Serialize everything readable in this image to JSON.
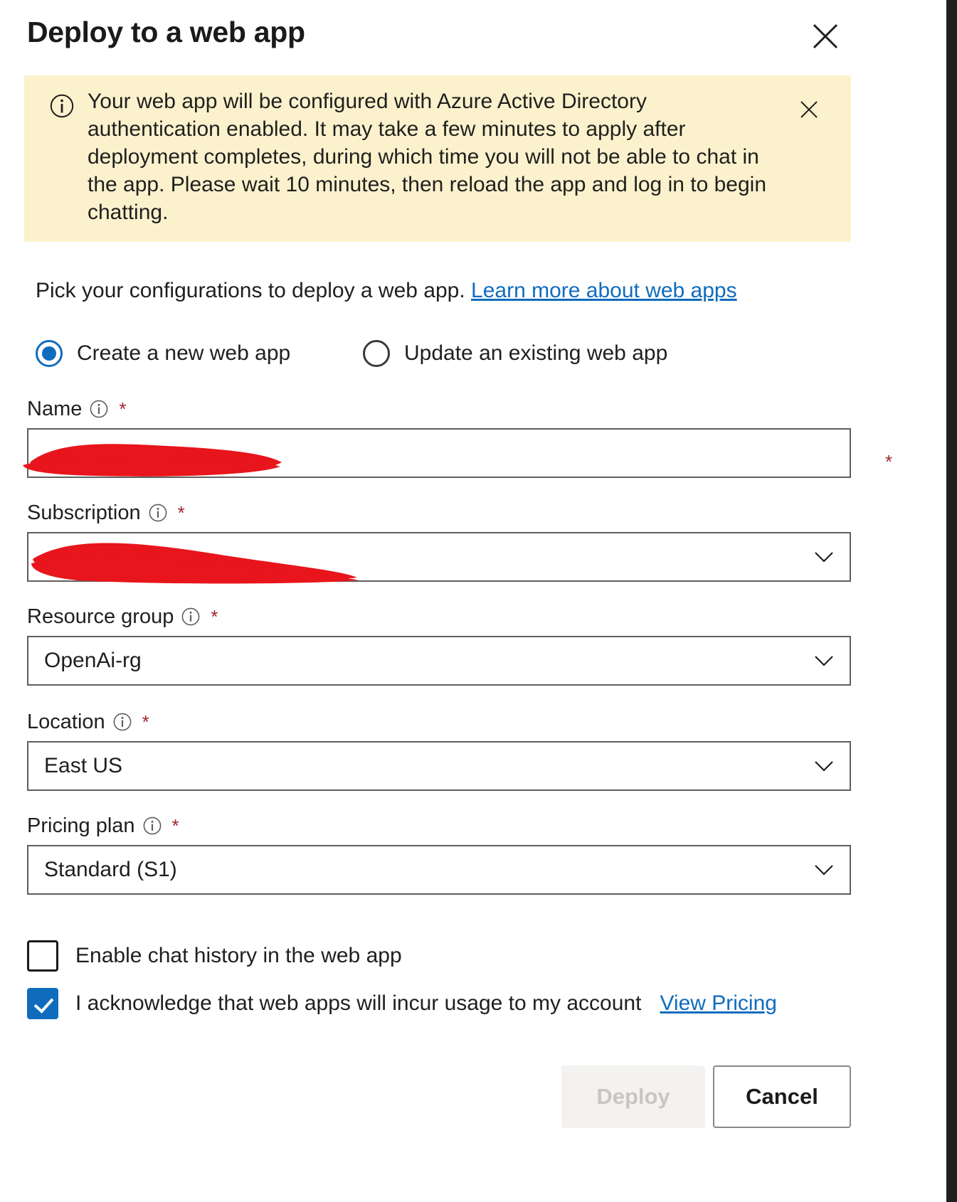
{
  "dialog": {
    "title": "Deploy to a web app",
    "close_icon": "close-icon"
  },
  "banner": {
    "icon": "info-circle-icon",
    "message": "Your web app will be configured with Azure Active Directory authentication enabled. It may take a few minutes to apply after deployment completes, during which time you will not be able to chat in the app. Please wait 10 minutes, then reload the app and log in to begin chatting.",
    "close_icon": "close-icon",
    "background_color": "#FBF2CD"
  },
  "intro": {
    "text": "Pick your configurations to deploy a web app. ",
    "link_text": "Learn more about web apps"
  },
  "mode": {
    "options": [
      {
        "label": "Create a new web app",
        "selected": true
      },
      {
        "label": "Update an existing web app",
        "selected": false
      }
    ]
  },
  "fields": [
    {
      "label": "Name",
      "required_mark": "*",
      "info_icon": "info-circle-icon",
      "type": "text",
      "value": "",
      "redacted": true,
      "outer_required_mark": "*"
    },
    {
      "label": "Subscription",
      "required_mark": "*",
      "info_icon": "info-circle-icon",
      "type": "select",
      "value": "",
      "redacted": true,
      "chevron_icon": "chevron-down-icon"
    },
    {
      "label": "Resource group",
      "required_mark": "*",
      "info_icon": "info-circle-icon",
      "type": "select",
      "value": "OpenAi-rg",
      "redacted": false,
      "chevron_icon": "chevron-down-icon"
    },
    {
      "label": "Location",
      "required_mark": "*",
      "info_icon": "info-circle-icon",
      "type": "select",
      "value": "East US",
      "redacted": false,
      "chevron_icon": "chevron-down-icon"
    },
    {
      "label": "Pricing plan",
      "required_mark": "*",
      "info_icon": "info-circle-icon",
      "type": "select",
      "value": "Standard (S1)",
      "redacted": false,
      "chevron_icon": "chevron-down-icon"
    }
  ],
  "checkboxes": [
    {
      "label": "Enable chat history in the web app",
      "checked": false
    },
    {
      "label": "I acknowledge that web apps will incur usage to my account",
      "checked": true
    }
  ],
  "pricing_link": "View Pricing",
  "footer": {
    "deploy_label": "Deploy",
    "deploy_disabled": true,
    "cancel_label": "Cancel"
  },
  "colors": {
    "accent": "#0F6CBD",
    "link": "#0F6CBD",
    "required": "#A4262C",
    "banner_bg": "#FBF2CD",
    "redaction": "#E8151C",
    "disabled_bg": "#F3F2F1",
    "disabled_text": "#C8C6C4"
  }
}
